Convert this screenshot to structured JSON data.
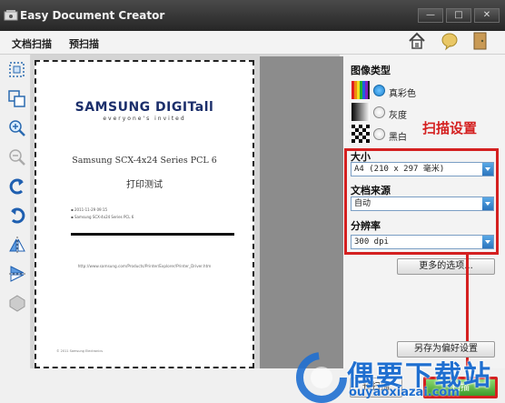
{
  "window": {
    "title": "Easy Document Creator",
    "minimize": "—",
    "maximize": "□",
    "close": "✕"
  },
  "menu": {
    "scan_doc": "文档扫描",
    "prescan": "预扫描"
  },
  "preview": {
    "brand": "SAMSUNG DIGITall",
    "brand_tagline": "everyone's invited",
    "heading": "Samsung SCX-4x24 Series PCL 6",
    "subheading": "打印测试",
    "bullets": [
      "2011-11-29 09:15",
      "Samsung SCX-4x24 Series PCL 6"
    ],
    "footer_url": "http://www.samsung.com/Products/Printer/Explorer/Printer_Driver.htm",
    "corner_note": "© 2011 Samsung Electronics"
  },
  "panel": {
    "image_type_title": "图像类型",
    "color_options": [
      {
        "label": "真彩色",
        "selected": true
      },
      {
        "label": "灰度",
        "selected": false
      },
      {
        "label": "黑白",
        "selected": false
      }
    ],
    "annotation": "扫描设置",
    "size_title": "大小",
    "size_value": "A4 (210 x 297 毫米)",
    "source_title": "文档来源",
    "source_value": "自动",
    "resolution_title": "分辨率",
    "resolution_value": "300 dpi",
    "more_options": "更多的选项...",
    "save_prefs": "另存为偏好设置",
    "prescan_btn": "预扫描",
    "scan_btn": "扫描"
  },
  "watermark": {
    "text": "偶要下载站",
    "url": "ouyaoxiazai.com"
  },
  "colors": {
    "accent_red": "#d42020",
    "selected_blue": "#1d82d0",
    "watermark_blue": "#1f6fd0"
  }
}
